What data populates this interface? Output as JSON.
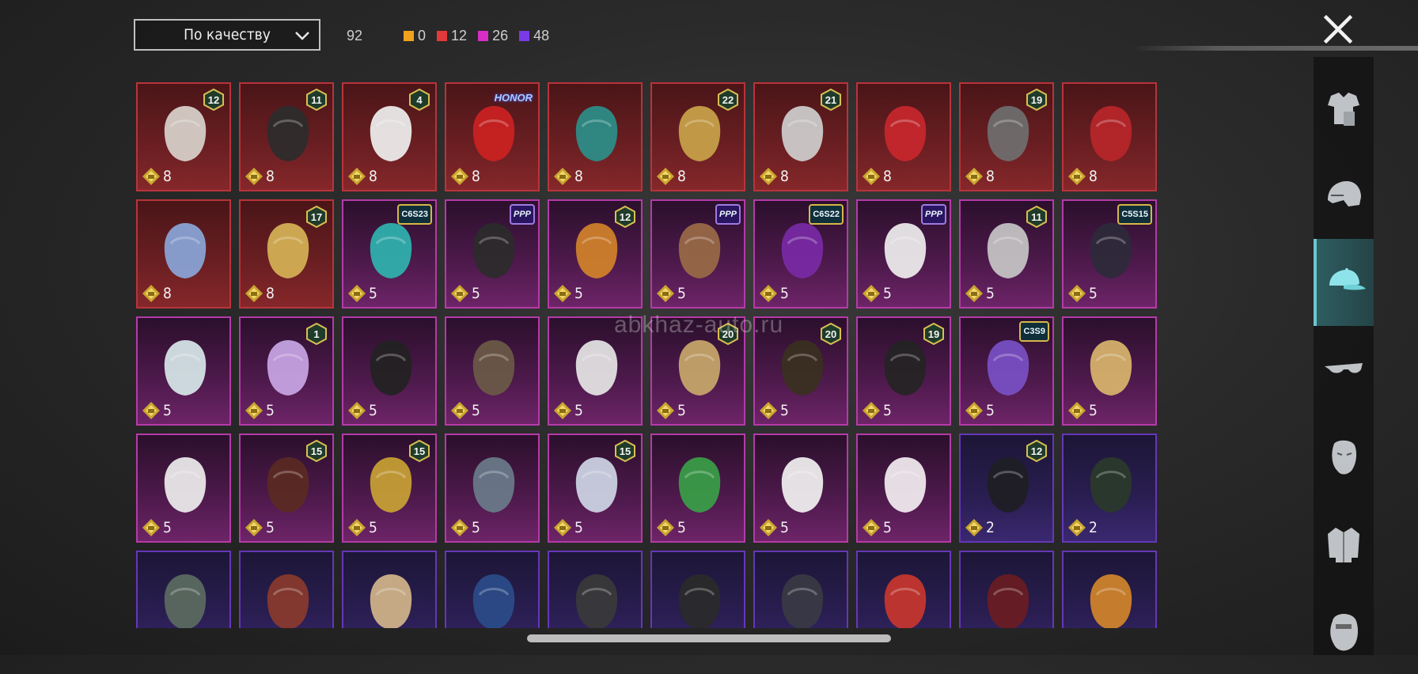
{
  "filter": {
    "sort_label": "По качеству",
    "total_count": "92",
    "quality_counts": [
      {
        "color": "#f0a21e",
        "value": "0"
      },
      {
        "color": "#e23a3a",
        "value": "12"
      },
      {
        "color": "#d62fc8",
        "value": "26"
      },
      {
        "color": "#7a3ae6",
        "value": "48"
      }
    ]
  },
  "watermark": "abkhaz-auto.ru",
  "sidebar": {
    "items": [
      {
        "icon": "outfit-icon",
        "active": false
      },
      {
        "icon": "helmet-icon",
        "active": false
      },
      {
        "icon": "cap-icon",
        "active": true
      },
      {
        "icon": "glasses-icon",
        "active": false
      },
      {
        "icon": "mask-icon",
        "active": false
      },
      {
        "icon": "jacket-icon",
        "active": false
      },
      {
        "icon": "face-icon",
        "active": false
      }
    ]
  },
  "items": [
    {
      "rarity": "red",
      "price": "8",
      "badge": "12",
      "icon": "white-hair-icon"
    },
    {
      "rarity": "red",
      "price": "8",
      "badge": "11",
      "icon": "black-hair-icon"
    },
    {
      "rarity": "red",
      "price": "8",
      "badge": "4",
      "icon": "snowman-hat-icon"
    },
    {
      "rarity": "red",
      "price": "8",
      "tag": "HONOR",
      "icon": "red-hair-hat-icon"
    },
    {
      "rarity": "red",
      "price": "8",
      "icon": "teal-crown-helmet-icon"
    },
    {
      "rarity": "red",
      "price": "8",
      "badge": "22",
      "icon": "gold-helmet-icon"
    },
    {
      "rarity": "red",
      "price": "8",
      "badge": "21",
      "icon": "oni-mask-icon"
    },
    {
      "rarity": "red",
      "price": "8",
      "icon": "red-horn-mask-icon"
    },
    {
      "rarity": "red",
      "price": "8",
      "badge": "19",
      "icon": "grey-helmet-icon"
    },
    {
      "rarity": "red",
      "price": "8",
      "icon": "red-helmet-icon"
    },
    {
      "rarity": "red",
      "price": "8",
      "icon": "wing-hair-icon"
    },
    {
      "rarity": "red",
      "price": "8",
      "badge": "17",
      "icon": "crown-mask-icon"
    },
    {
      "rarity": "magenta",
      "price": "5",
      "tag": "C6S23",
      "icon": "cat-headphones-icon"
    },
    {
      "rarity": "magenta",
      "price": "5",
      "tag": "PPP",
      "icon": "black-cap-glasses-icon"
    },
    {
      "rarity": "magenta",
      "price": "5",
      "badge": "12",
      "icon": "orange-hair-icon"
    },
    {
      "rarity": "magenta",
      "price": "5",
      "tag": "PPP",
      "icon": "bear-mask-icon"
    },
    {
      "rarity": "magenta",
      "price": "5",
      "tag": "C6S22",
      "icon": "purple-hair-icon"
    },
    {
      "rarity": "magenta",
      "price": "5",
      "tag": "PPP",
      "icon": "panda-mask-icon"
    },
    {
      "rarity": "magenta",
      "price": "5",
      "badge": "11",
      "icon": "flower-hair-icon"
    },
    {
      "rarity": "magenta",
      "price": "5",
      "tag": "C5S15",
      "icon": "dark-cap-icon"
    },
    {
      "rarity": "magenta",
      "price": "5",
      "icon": "silver-hair-icon"
    },
    {
      "rarity": "magenta",
      "price": "5",
      "badge": "1",
      "icon": "pastel-hair-icon"
    },
    {
      "rarity": "magenta",
      "price": "5",
      "icon": "braids-hair-icon"
    },
    {
      "rarity": "magenta",
      "price": "5",
      "icon": "long-brown-hair-icon"
    },
    {
      "rarity": "magenta",
      "price": "5",
      "icon": "samurai-helmet-icon"
    },
    {
      "rarity": "magenta",
      "price": "5",
      "badge": "20",
      "icon": "blonde-horn-hair-icon"
    },
    {
      "rarity": "magenta",
      "price": "5",
      "badge": "20",
      "icon": "dark-gold-mask-icon"
    },
    {
      "rarity": "magenta",
      "price": "5",
      "badge": "19",
      "icon": "black-bun-hair-icon"
    },
    {
      "rarity": "magenta",
      "price": "5",
      "tag": "C3S9",
      "icon": "purple-hat-icon"
    },
    {
      "rarity": "magenta",
      "price": "5",
      "icon": "blonde-ponytails-icon"
    },
    {
      "rarity": "magenta",
      "price": "5",
      "icon": "gold-crown-hair-icon"
    },
    {
      "rarity": "magenta",
      "price": "5",
      "badge": "15",
      "icon": "red-spike-helmet-icon"
    },
    {
      "rarity": "magenta",
      "price": "5",
      "badge": "15",
      "icon": "gold-helmet-visor-icon"
    },
    {
      "rarity": "magenta",
      "price": "5",
      "icon": "shark-hat-icon"
    },
    {
      "rarity": "magenta",
      "price": "5",
      "badge": "15",
      "icon": "blue-robot-helmet-icon"
    },
    {
      "rarity": "magenta",
      "price": "5",
      "icon": "frog-hat-icon"
    },
    {
      "rarity": "magenta",
      "price": "5",
      "icon": "maid-headband-icon"
    },
    {
      "rarity": "magenta",
      "price": "5",
      "icon": "white-sun-hat-icon"
    },
    {
      "rarity": "violet",
      "price": "2",
      "badge": "12",
      "icon": "bunny-helmet-icon"
    },
    {
      "rarity": "violet",
      "price": "2",
      "icon": "gas-mask-helmet-icon"
    },
    {
      "rarity": "violet",
      "icon": "army-helmet-icon"
    },
    {
      "rarity": "violet",
      "icon": "goggles-hair-icon"
    },
    {
      "rarity": "violet",
      "icon": "bunny-ear-hat-icon"
    },
    {
      "rarity": "violet",
      "icon": "blue-hood-icon"
    },
    {
      "rarity": "violet",
      "icon": "black-cap-icon"
    },
    {
      "rarity": "violet",
      "icon": "snapback-cap-icon"
    },
    {
      "rarity": "violet",
      "icon": "witch-hat-icon"
    },
    {
      "rarity": "violet",
      "icon": "moto-helmet-icon"
    },
    {
      "rarity": "violet",
      "icon": "red-bow-hair-icon"
    },
    {
      "rarity": "violet",
      "icon": "cyber-helmet-icon"
    }
  ]
}
